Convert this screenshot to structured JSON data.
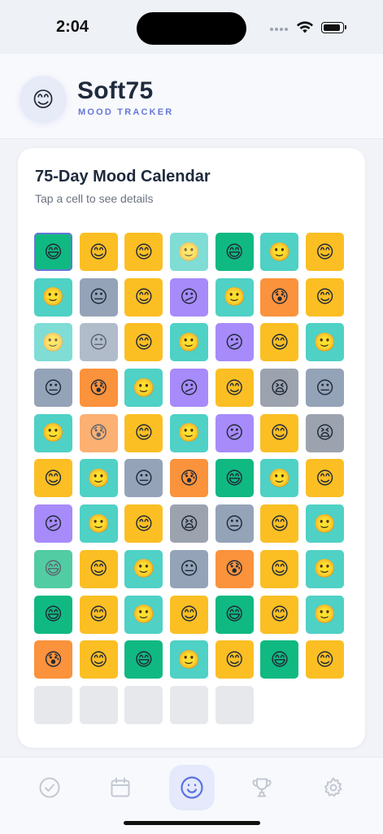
{
  "status": {
    "time": "2:04"
  },
  "header": {
    "logo_emoji": "😊",
    "title": "Soft75",
    "subtitle": "MOOD TRACKER"
  },
  "calendar": {
    "title": "75-Day Mood Calendar",
    "hint": "Tap a cell to see details",
    "days": [
      {
        "emoji": "😄",
        "mood": "great",
        "selected": true
      },
      {
        "emoji": "😊",
        "mood": "good"
      },
      {
        "emoji": "😊",
        "mood": "good"
      },
      {
        "emoji": "🙂",
        "mood": "okay",
        "faded": true
      },
      {
        "emoji": "😄",
        "mood": "great"
      },
      {
        "emoji": "🙂",
        "mood": "okay"
      },
      {
        "emoji": "😊",
        "mood": "good"
      },
      {
        "emoji": "🙂",
        "mood": "okay"
      },
      {
        "emoji": "😐",
        "mood": "meh"
      },
      {
        "emoji": "😊",
        "mood": "good"
      },
      {
        "emoji": "😕",
        "mood": "sad"
      },
      {
        "emoji": "🙂",
        "mood": "okay"
      },
      {
        "emoji": "😰",
        "mood": "anxious"
      },
      {
        "emoji": "😊",
        "mood": "good"
      },
      {
        "emoji": "🙂",
        "mood": "okay",
        "faded": true
      },
      {
        "emoji": "😐",
        "mood": "meh",
        "faded": true
      },
      {
        "emoji": "😊",
        "mood": "good"
      },
      {
        "emoji": "🙂",
        "mood": "okay"
      },
      {
        "emoji": "😕",
        "mood": "sad"
      },
      {
        "emoji": "😊",
        "mood": "good"
      },
      {
        "emoji": "🙂",
        "mood": "okay"
      },
      {
        "emoji": "😐",
        "mood": "meh"
      },
      {
        "emoji": "😰",
        "mood": "anxious"
      },
      {
        "emoji": "🙂",
        "mood": "okay"
      },
      {
        "emoji": "😕",
        "mood": "sad"
      },
      {
        "emoji": "😊",
        "mood": "good"
      },
      {
        "emoji": "😫",
        "mood": "stressed"
      },
      {
        "emoji": "😐",
        "mood": "meh"
      },
      {
        "emoji": "🙂",
        "mood": "okay"
      },
      {
        "emoji": "😰",
        "mood": "anxious",
        "faded": true
      },
      {
        "emoji": "😊",
        "mood": "good"
      },
      {
        "emoji": "🙂",
        "mood": "okay"
      },
      {
        "emoji": "😕",
        "mood": "sad"
      },
      {
        "emoji": "😊",
        "mood": "good"
      },
      {
        "emoji": "😫",
        "mood": "stressed"
      },
      {
        "emoji": "😊",
        "mood": "good"
      },
      {
        "emoji": "🙂",
        "mood": "okay"
      },
      {
        "emoji": "😐",
        "mood": "meh"
      },
      {
        "emoji": "😰",
        "mood": "anxious"
      },
      {
        "emoji": "😄",
        "mood": "great"
      },
      {
        "emoji": "🙂",
        "mood": "okay"
      },
      {
        "emoji": "😊",
        "mood": "good"
      },
      {
        "emoji": "😕",
        "mood": "sad"
      },
      {
        "emoji": "🙂",
        "mood": "okay"
      },
      {
        "emoji": "😊",
        "mood": "good"
      },
      {
        "emoji": "😫",
        "mood": "stressed"
      },
      {
        "emoji": "😐",
        "mood": "meh"
      },
      {
        "emoji": "😊",
        "mood": "good"
      },
      {
        "emoji": "🙂",
        "mood": "okay"
      },
      {
        "emoji": "😄",
        "mood": "great",
        "faded": true
      },
      {
        "emoji": "😊",
        "mood": "good"
      },
      {
        "emoji": "🙂",
        "mood": "okay"
      },
      {
        "emoji": "😐",
        "mood": "meh"
      },
      {
        "emoji": "😰",
        "mood": "anxious"
      },
      {
        "emoji": "😊",
        "mood": "good"
      },
      {
        "emoji": "🙂",
        "mood": "okay"
      },
      {
        "emoji": "😄",
        "mood": "great"
      },
      {
        "emoji": "😊",
        "mood": "good"
      },
      {
        "emoji": "🙂",
        "mood": "okay"
      },
      {
        "emoji": "😊",
        "mood": "good"
      },
      {
        "emoji": "😄",
        "mood": "great"
      },
      {
        "emoji": "😊",
        "mood": "good"
      },
      {
        "emoji": "🙂",
        "mood": "okay"
      },
      {
        "emoji": "😰",
        "mood": "anxious"
      },
      {
        "emoji": "😊",
        "mood": "good"
      },
      {
        "emoji": "😄",
        "mood": "great"
      },
      {
        "emoji": "🙂",
        "mood": "okay"
      },
      {
        "emoji": "😊",
        "mood": "good"
      },
      {
        "emoji": "😄",
        "mood": "great"
      },
      {
        "emoji": "😊",
        "mood": "good"
      },
      {
        "emoji": "",
        "mood": "empty"
      },
      {
        "emoji": "",
        "mood": "empty"
      },
      {
        "emoji": "",
        "mood": "empty"
      },
      {
        "emoji": "",
        "mood": "empty"
      },
      {
        "emoji": "",
        "mood": "empty"
      }
    ]
  },
  "tabbar": {
    "active": "mood",
    "tabs": [
      {
        "id": "checklist",
        "icon": "check-circle-icon"
      },
      {
        "id": "calendar",
        "icon": "calendar-icon"
      },
      {
        "id": "mood",
        "icon": "smiley-icon"
      },
      {
        "id": "achievements",
        "icon": "trophy-icon"
      },
      {
        "id": "settings",
        "icon": "gear-icon"
      }
    ],
    "colors": {
      "active": "#5b72e0",
      "inactive": "#c3c8d2"
    }
  }
}
